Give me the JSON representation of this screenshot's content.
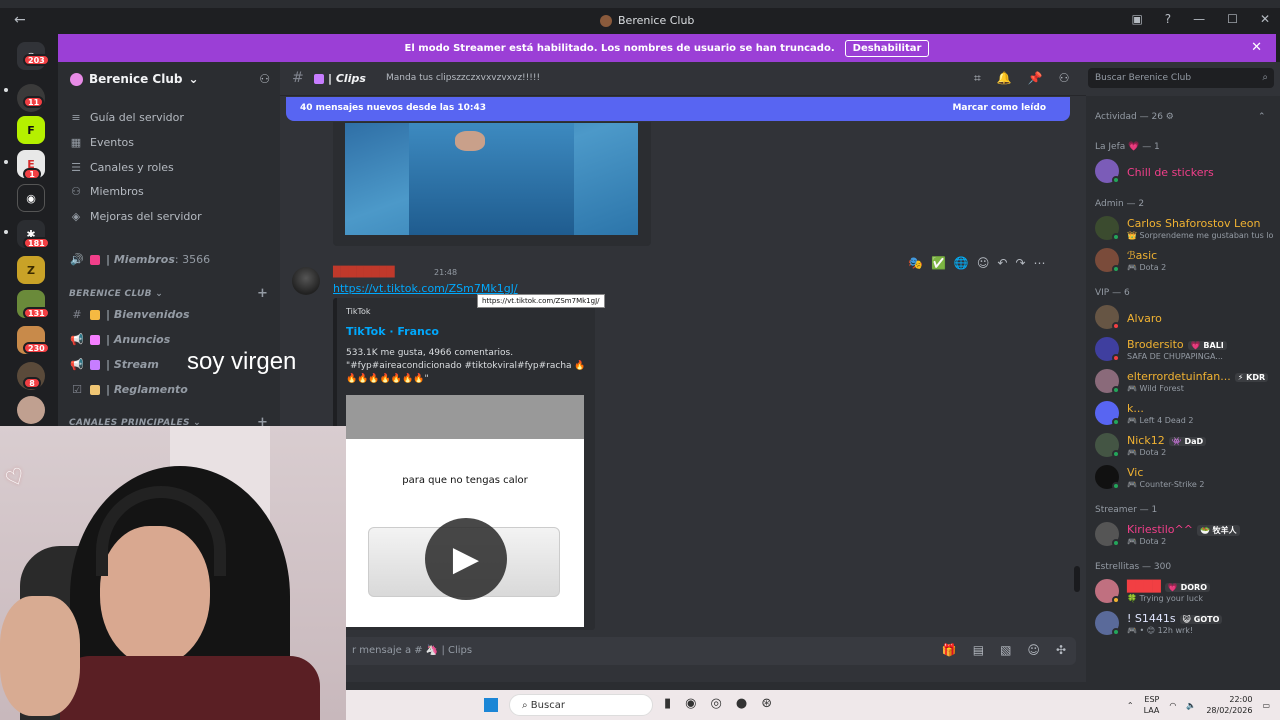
{
  "window": {
    "title": "Berenice Club"
  },
  "banner": {
    "text": "El modo Streamer está habilitado. Los nombres de usuario se han truncado.",
    "button": "Deshabilitar"
  },
  "rail": {
    "badges": [
      "203",
      "11",
      "1",
      "181",
      "131",
      "230",
      "8"
    ]
  },
  "server": {
    "name": "Berenice Club"
  },
  "nav": [
    {
      "label": "Guía del servidor",
      "icon": "guide-icon"
    },
    {
      "label": "Eventos",
      "icon": "calendar-icon"
    },
    {
      "label": "Canales y roles",
      "icon": "channels-icon"
    },
    {
      "label": "Miembros",
      "icon": "members-icon"
    },
    {
      "label": "Mejoras del servidor",
      "icon": "boost-icon"
    }
  ],
  "members_channel": {
    "name": "| Miembros",
    "count": ": 3566"
  },
  "category_1": "BERENICE CLUB",
  "channels": [
    {
      "name": "| Bienvenidos",
      "emoji_color": "#f5b942"
    },
    {
      "name": "| Anuncios",
      "emoji_color": "#f47fff"
    },
    {
      "name": "| Stream",
      "emoji_color": "#c77dff"
    },
    {
      "name": "| Reglamento",
      "emoji_color": "#f0c674"
    }
  ],
  "category_2": "CANALES PRINCIPALES",
  "overlay_text": "soy virgen",
  "header": {
    "channel": "| Clips",
    "topic": "Manda tus clipszzczxvxvzvxvz!!!!!",
    "search_placeholder": "Buscar Berenice Club"
  },
  "new_messages": {
    "text": "40 mensajes nuevos desde las 10:43",
    "mark_read": "Marcar como leído"
  },
  "message": {
    "author": "████████",
    "time": "21:48",
    "link": "https://vt.tiktok.com/ZSm7Mk1gJ/",
    "tooltip": "https://vt.tiktok.com/ZSm7Mk1gJ/",
    "embed": {
      "provider": "TikTok",
      "title": "TikTok · Franco",
      "stats": "533.1K me gusta, 4966 comentarios.",
      "desc": "\"#fyp#aireacondicionado #tiktokviral#fyp#racha 🔥🔥🔥🔥🔥🔥🔥🔥\"",
      "video_caption": "para que no tengas calor"
    }
  },
  "composer": {
    "placeholder": "r mensaje a # 🦄 | Clips"
  },
  "members": {
    "activity": "Actividad — 26",
    "groups": [
      {
        "heading": "La Jefa 💗 — 1",
        "items": [
          {
            "name": "Chill de stickers",
            "color": "#f23f8a",
            "sub": "",
            "status": "#23a55a",
            "av": "#7b5cb8"
          }
        ]
      },
      {
        "heading": "Admin — 2",
        "items": [
          {
            "name": "Carlos Shaforostov Leon",
            "color": "#f0b232",
            "sub": "👑 Sorprendeme me gustaban tus lo",
            "status": "#23a55a",
            "av": "#3b4b2f"
          },
          {
            "name": "ℬasic",
            "color": "#f0b232",
            "sub": "🎮 Dota 2",
            "status": "#23a55a",
            "av": "#7a4b3a"
          }
        ]
      },
      {
        "heading": "VIP — 6",
        "items": [
          {
            "name": "Alvaro",
            "color": "#f0b232",
            "sub": "",
            "status": "#f23f43",
            "av": "#665544"
          },
          {
            "name": "Brodersito",
            "tag": "💗 BALI",
            "color": "#f0b232",
            "sub": "SAFA DE CHUPAPINGA...",
            "status": "#f23f43",
            "av": "#3f3f9f"
          },
          {
            "name": "elterrordetuinfan...",
            "tag": "⚡ KDR",
            "color": "#f0b232",
            "sub": "🎮 Wild Forest",
            "status": "#23a55a",
            "av": "#8a6a7a"
          },
          {
            "name": "k...",
            "color": "#f0b232",
            "sub": "🎮 Left 4 Dead 2",
            "status": "#23a55a",
            "av": "#5865f2"
          },
          {
            "name": "Nick12",
            "tag": "👾 DaD",
            "color": "#f0b232",
            "sub": "🎮 Dota 2",
            "status": "#23a55a",
            "av": "#445544"
          },
          {
            "name": "Vic",
            "color": "#f0b232",
            "sub": "🎮 Counter-Strike 2",
            "status": "#23a55a",
            "av": "#111111"
          }
        ]
      },
      {
        "heading": "Streamer — 1",
        "items": [
          {
            "name": "Kiriestilo^^",
            "tag": "🥗 牧羊人",
            "color": "#f23f8a",
            "sub": "🎮 Dota 2",
            "status": "#23a55a",
            "av": "#555555"
          }
        ]
      },
      {
        "heading": "Estrellitas — 300",
        "items": [
          {
            "name": "████",
            "tag": "💗 DORO",
            "color": "#f23f43",
            "sub": "🍀 Trying your luck",
            "status": "#f0b232",
            "av": "#c07080"
          },
          {
            "name": "! S1441s",
            "tag": "😺 GOTO",
            "color": "#e0e6ff",
            "sub": "🎮 • 😊 12h wrk!",
            "status": "#23a55a",
            "av": "#5a6a9a"
          }
        ]
      }
    ]
  },
  "taskbar": {
    "search": "Buscar",
    "lang": "ESP",
    "lang2": "LAA",
    "time": "22:00",
    "date": "28/02/2026"
  },
  "colors": {
    "accent": "#5865f2",
    "banner": "#9b3fd6",
    "link": "#00a8fc"
  }
}
